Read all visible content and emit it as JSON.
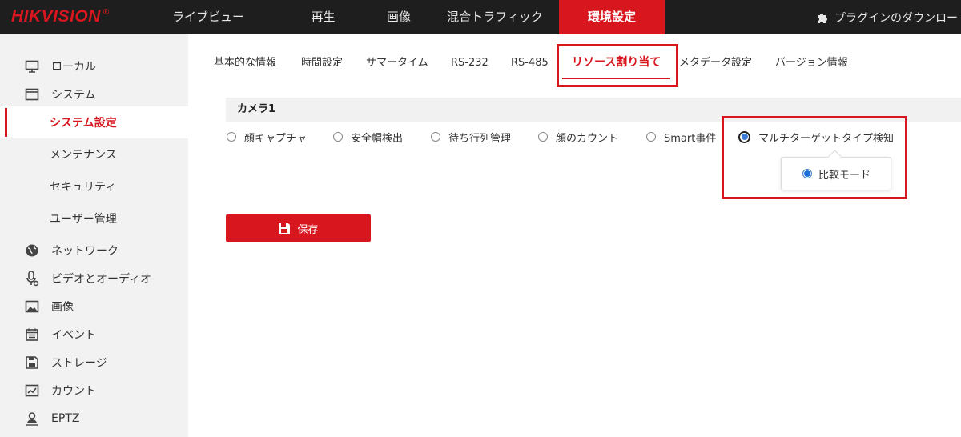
{
  "brand": {
    "logo_text": "HIKVISION",
    "registered_mark": "®",
    "accent_color": "#d7161e"
  },
  "top_nav": {
    "items": [
      {
        "label": "ライブビュー"
      },
      {
        "label": "再生"
      },
      {
        "label": "画像"
      },
      {
        "label": "混合トラフィック"
      },
      {
        "label": "環境設定",
        "active": true
      }
    ],
    "plugin_label": "プラグインのダウンロード"
  },
  "sidebar": {
    "items": [
      {
        "label": "ローカル",
        "icon": "monitor-icon"
      },
      {
        "label": "システム",
        "icon": "window-icon"
      },
      {
        "label": "システム設定",
        "active": true
      },
      {
        "label": "メンテナンス"
      },
      {
        "label": "セキュリティ"
      },
      {
        "label": "ユーザー管理"
      },
      {
        "label": "ネットワーク",
        "icon": "globe-icon"
      },
      {
        "label": "ビデオとオーディオ",
        "icon": "mic-icon"
      },
      {
        "label": "画像",
        "icon": "image-icon"
      },
      {
        "label": "イベント",
        "icon": "calendar-icon"
      },
      {
        "label": "ストレージ",
        "icon": "save-icon"
      },
      {
        "label": "カウント",
        "icon": "chart-icon"
      },
      {
        "label": "EPTZ",
        "icon": "person-icon"
      }
    ]
  },
  "tabs": [
    {
      "label": "基本的な情報"
    },
    {
      "label": "時間設定"
    },
    {
      "label": "サマータイム"
    },
    {
      "label": "RS-232"
    },
    {
      "label": "RS-485"
    },
    {
      "label": "リソース割り当て",
      "active": true
    },
    {
      "label": "メタデータ設定"
    },
    {
      "label": "バージョン情報"
    }
  ],
  "main": {
    "camera_title": "カメラ1",
    "options": [
      {
        "label": "顔キャプチャ",
        "checked": false
      },
      {
        "label": "安全帽検出",
        "checked": false
      },
      {
        "label": "待ち行列管理",
        "checked": false
      },
      {
        "label": "顔のカウント",
        "checked": false
      },
      {
        "label": "Smart事件",
        "checked": false
      },
      {
        "label": "マルチターゲットタイプ検知",
        "checked": true
      }
    ],
    "sub_option": {
      "label": "比較モード",
      "checked": true
    },
    "save_label": "保存"
  }
}
